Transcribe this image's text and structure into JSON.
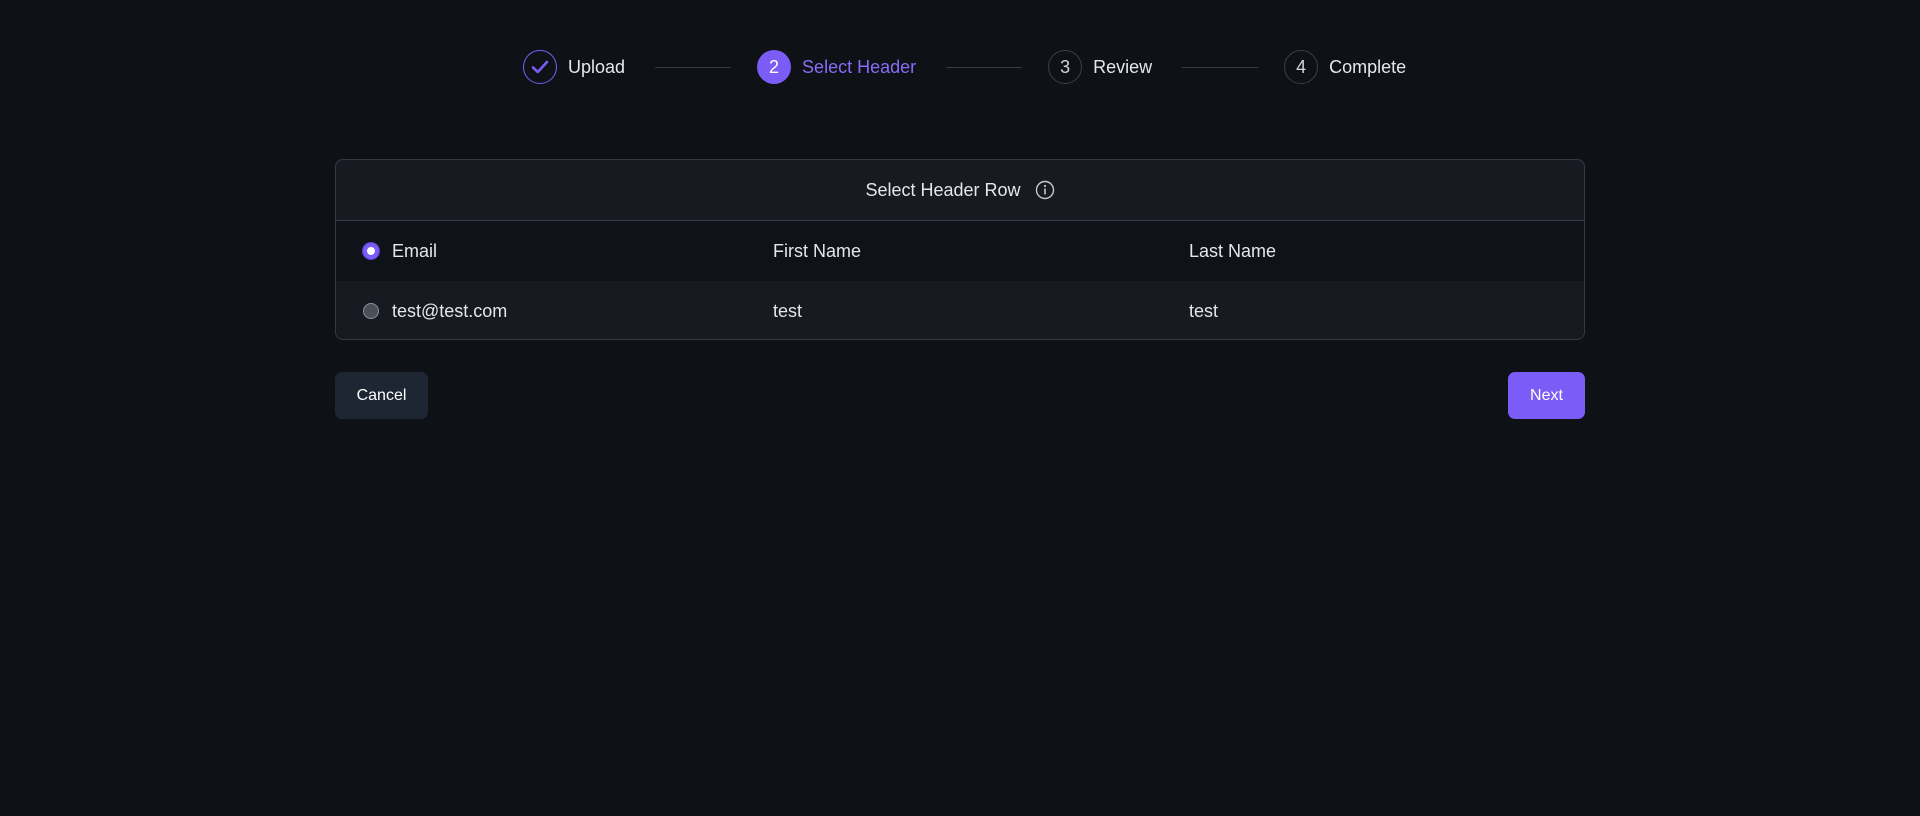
{
  "stepper": {
    "steps": [
      {
        "number": "",
        "label": "Upload",
        "state": "done",
        "icon": "check-icon"
      },
      {
        "number": "2",
        "label": "Select Header",
        "state": "active"
      },
      {
        "number": "3",
        "label": "Review",
        "state": "pending"
      },
      {
        "number": "4",
        "label": "Complete",
        "state": "pending"
      }
    ]
  },
  "card": {
    "title": "Select Header Row",
    "info_icon": "info-icon",
    "rows": [
      {
        "selected": true,
        "cells": [
          "Email",
          "First Name",
          "Last Name"
        ]
      },
      {
        "selected": false,
        "cells": [
          "test@test.com",
          "test",
          "test"
        ]
      }
    ]
  },
  "actions": {
    "cancel_label": "Cancel",
    "next_label": "Next"
  },
  "colors": {
    "accent": "#7c5cf6",
    "background": "#0e1116",
    "card_background": "#171a21",
    "border": "#343944",
    "cancel_button": "#1e2634"
  }
}
